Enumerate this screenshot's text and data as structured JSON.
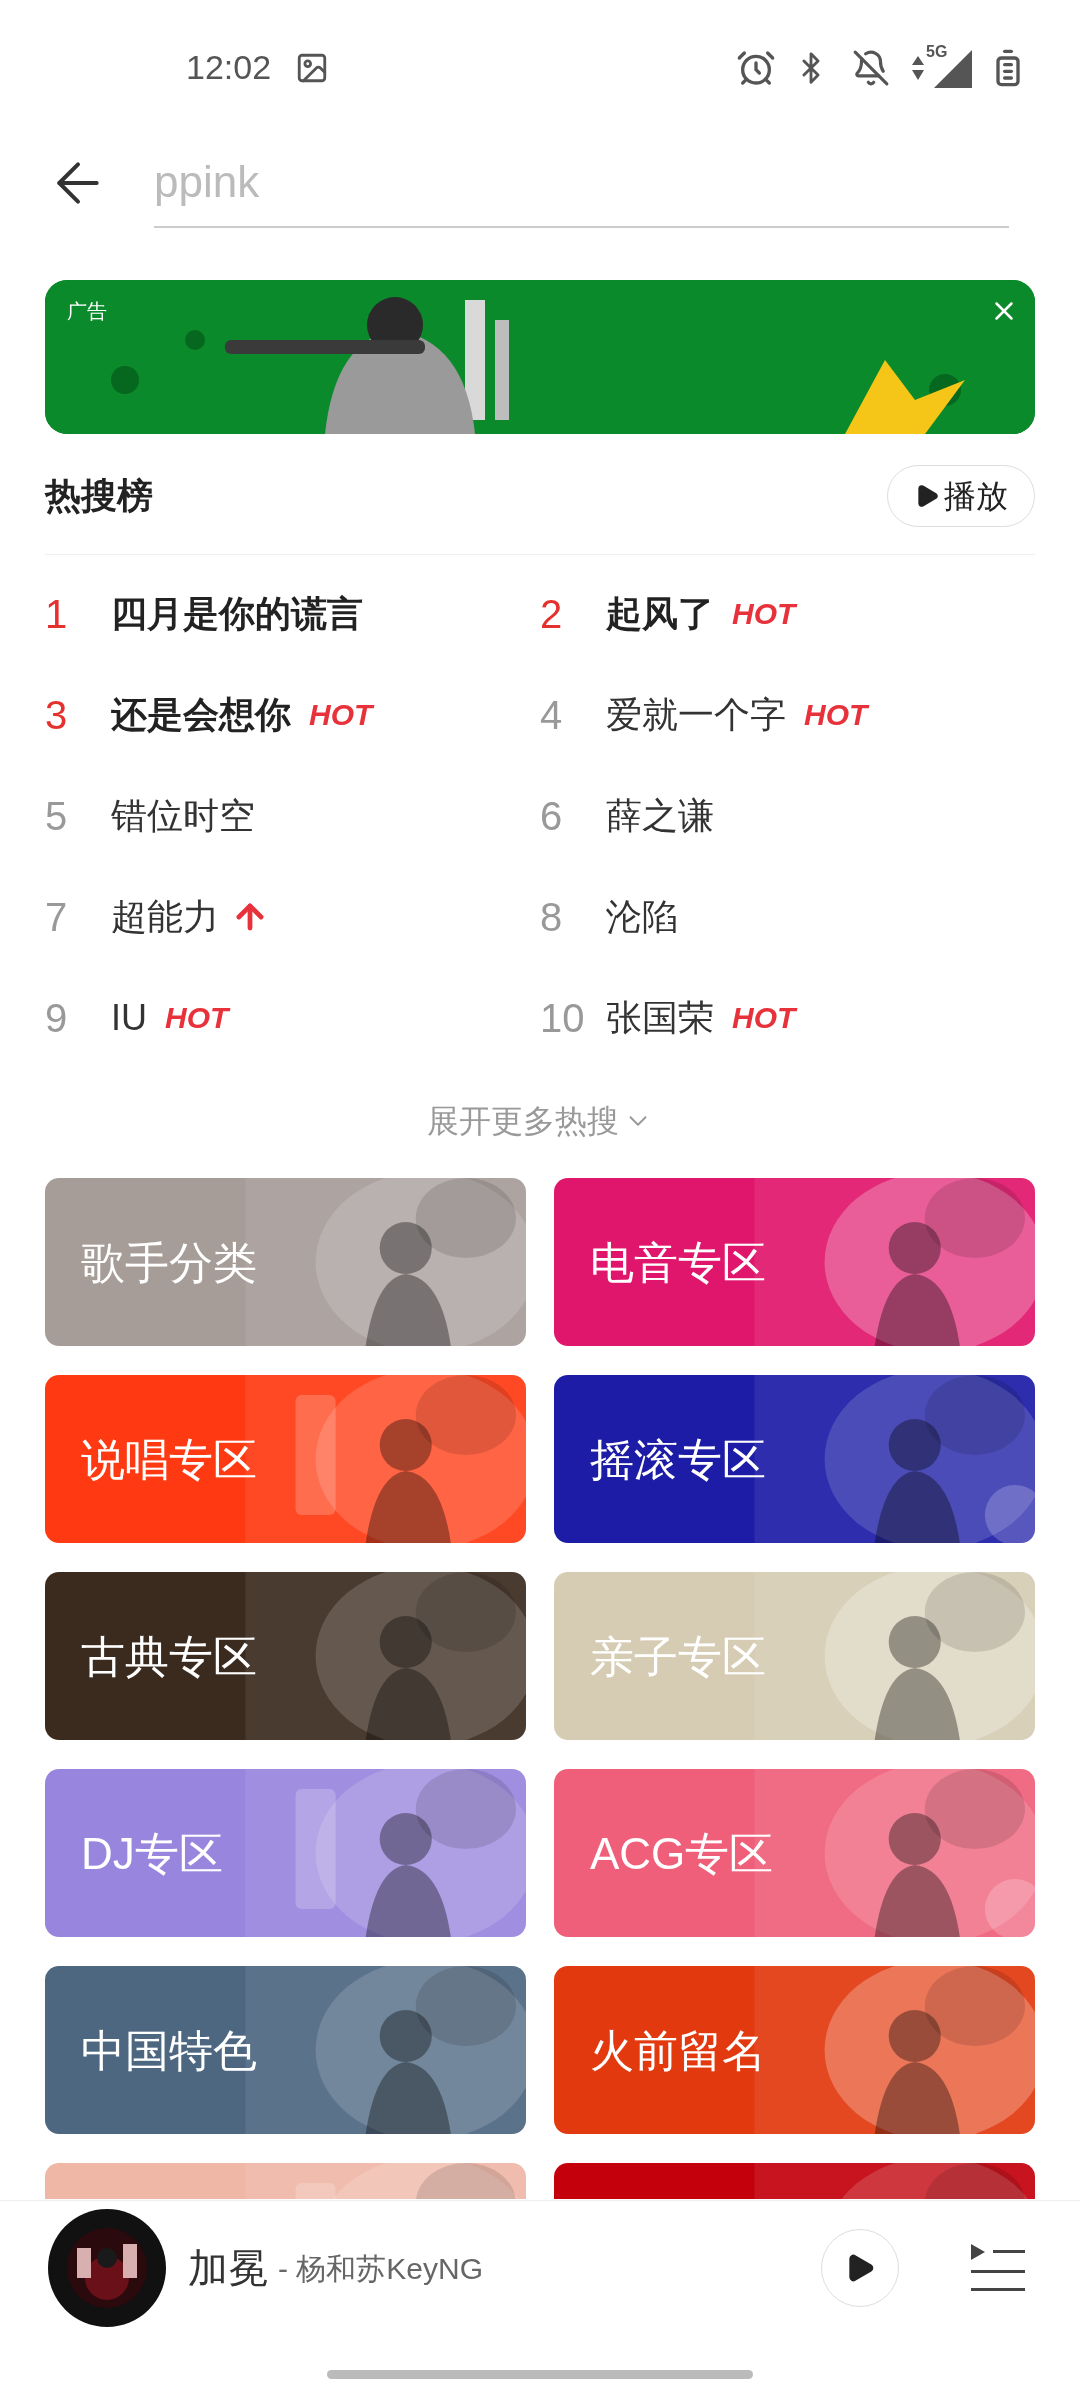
{
  "status_bar": {
    "time": "12:02",
    "network": "5G"
  },
  "search": {
    "placeholder": "ppink"
  },
  "ad": {
    "label": "广告"
  },
  "hot_search": {
    "title": "热搜榜",
    "play_button": "播放",
    "expand": "展开更多热搜",
    "items": [
      {
        "rank": "1",
        "title": "四月是你的谎言",
        "top": true,
        "kind": "plain"
      },
      {
        "rank": "2",
        "title": "起风了",
        "top": true,
        "kind": "hot",
        "badge": "HOT"
      },
      {
        "rank": "3",
        "title": "还是会想你",
        "top": true,
        "kind": "hot",
        "badge": "HOT"
      },
      {
        "rank": "4",
        "title": "爱就一个字",
        "top": false,
        "kind": "hot",
        "badge": "HOT"
      },
      {
        "rank": "5",
        "title": "错位时空",
        "top": false,
        "kind": "plain"
      },
      {
        "rank": "6",
        "title": "薛之谦",
        "top": false,
        "kind": "plain"
      },
      {
        "rank": "7",
        "title": "超能力",
        "top": false,
        "kind": "up"
      },
      {
        "rank": "8",
        "title": "沦陷",
        "top": false,
        "kind": "plain"
      },
      {
        "rank": "9",
        "title": "IU",
        "top": false,
        "kind": "hot",
        "badge": "HOT"
      },
      {
        "rank": "10",
        "title": "张国荣",
        "top": false,
        "kind": "hot",
        "badge": "HOT"
      }
    ]
  },
  "categories": [
    {
      "label": "歌手分类",
      "color": "#a69d99"
    },
    {
      "label": "电音专区",
      "color": "#e0166c"
    },
    {
      "label": "说唱专区",
      "color": "#ff3a12"
    },
    {
      "label": "摇滚专区",
      "color": "#1c1ca6"
    },
    {
      "label": "古典专区",
      "color": "#3b2b1f"
    },
    {
      "label": "亲子专区",
      "color": "#d6ccb4"
    },
    {
      "label": "DJ专区",
      "color": "#9886de"
    },
    {
      "label": "ACG专区",
      "color": "#ef5f7a"
    },
    {
      "label": "中国特色",
      "color": "#4d6780"
    },
    {
      "label": "火前留名",
      "color": "#e2390f"
    },
    {
      "color": "#efb7a6"
    },
    {
      "color": "#c3000b"
    }
  ],
  "player": {
    "title": "加冕",
    "artist": "- 杨和苏KeyNG"
  }
}
